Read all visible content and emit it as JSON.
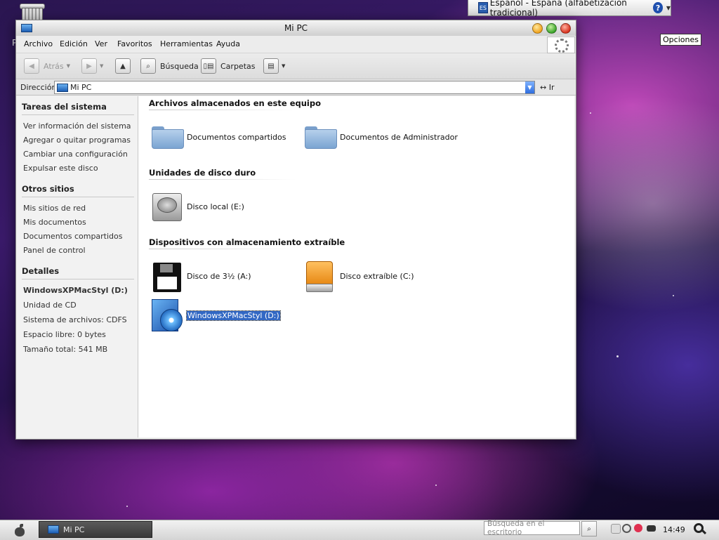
{
  "window": {
    "title": "Mi PC",
    "menu": [
      "Archivo",
      "Edición",
      "Ver",
      "Favoritos",
      "Herramientas",
      "Ayuda"
    ]
  },
  "toolbar": {
    "back": "Atrás",
    "search": "Búsqueda",
    "folders": "Carpetas"
  },
  "address": {
    "label": "Dirección",
    "value": "Mi PC",
    "go": "Ir"
  },
  "sidebar": {
    "system_tasks": {
      "title": "Tareas del sistema",
      "items": [
        "Ver información del sistema",
        "Agregar o quitar programas",
        "Cambiar una configuración",
        "Expulsar este disco"
      ]
    },
    "other_places": {
      "title": "Otros sitios",
      "items": [
        "Mis sitios de red",
        "Mis documentos",
        "Documentos compartidos",
        "Panel de control"
      ]
    },
    "details": {
      "title": "Detalles",
      "name": "WindowsXPMacStyl (D:)",
      "lines": [
        "Unidad de CD",
        "Sistema de archivos: CDFS",
        "Espacio libre: 0 bytes",
        "Tamaño total: 541 MB"
      ]
    }
  },
  "groups": [
    {
      "title": "Archivos almacenados en este equipo",
      "items": [
        {
          "label": "Documentos compartidos",
          "icon": "folder-icon"
        },
        {
          "label": "Documentos de Administrador",
          "icon": "folder-icon"
        }
      ]
    },
    {
      "title": "Unidades de disco duro",
      "items": [
        {
          "label": "Disco local (E:)",
          "icon": "hard-disk-icon"
        }
      ]
    },
    {
      "title": "Dispositivos con almacenamiento extraíble",
      "items": [
        {
          "label": "Disco de 3½ (A:)",
          "icon": "floppy-icon"
        },
        {
          "label": "Disco extraíble (C:)",
          "icon": "removable-drive-icon"
        },
        {
          "label": "WindowsXPMacStyl (D:)",
          "icon": "cd-drive-icon",
          "selected": true
        }
      ]
    }
  ],
  "language_bar": {
    "code": "ES",
    "text": "Español - España (alfabetización tradicional)"
  },
  "tooltip": "Opciones",
  "desktop_letter": "P",
  "taskbar": {
    "task_label": "Mi PC",
    "search_placeholder": "Búsqueda en el escritorio",
    "clock": "14:49"
  },
  "colors": {
    "selection": "#3268c4",
    "removable_drive": "#f0a020"
  }
}
